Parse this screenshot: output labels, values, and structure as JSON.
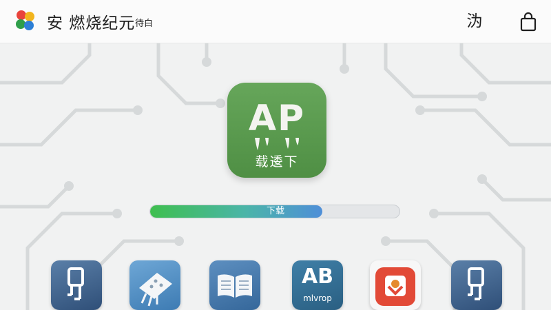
{
  "header": {
    "title": "安 燃烧纪元",
    "subtitle": "待白",
    "right_glyph": "沩",
    "logo_icon": "flower-logo-icon",
    "bag_icon": "shopping-bag-icon"
  },
  "app": {
    "icon_letters": "AP",
    "icon_caption": "载逶下",
    "accent_color": "#5a9a4f"
  },
  "download": {
    "label": "下载",
    "progress_fraction": 0.69
  },
  "dock": [
    {
      "icon": "circuit-chip-icon"
    },
    {
      "icon": "circuit-board-icon"
    },
    {
      "icon": "open-book-icon"
    },
    {
      "icon": "ab-app-icon",
      "letters": "AB",
      "caption": "mlvrop"
    },
    {
      "icon": "red-badge-icon"
    },
    {
      "icon": "circuit-chip-icon"
    }
  ]
}
